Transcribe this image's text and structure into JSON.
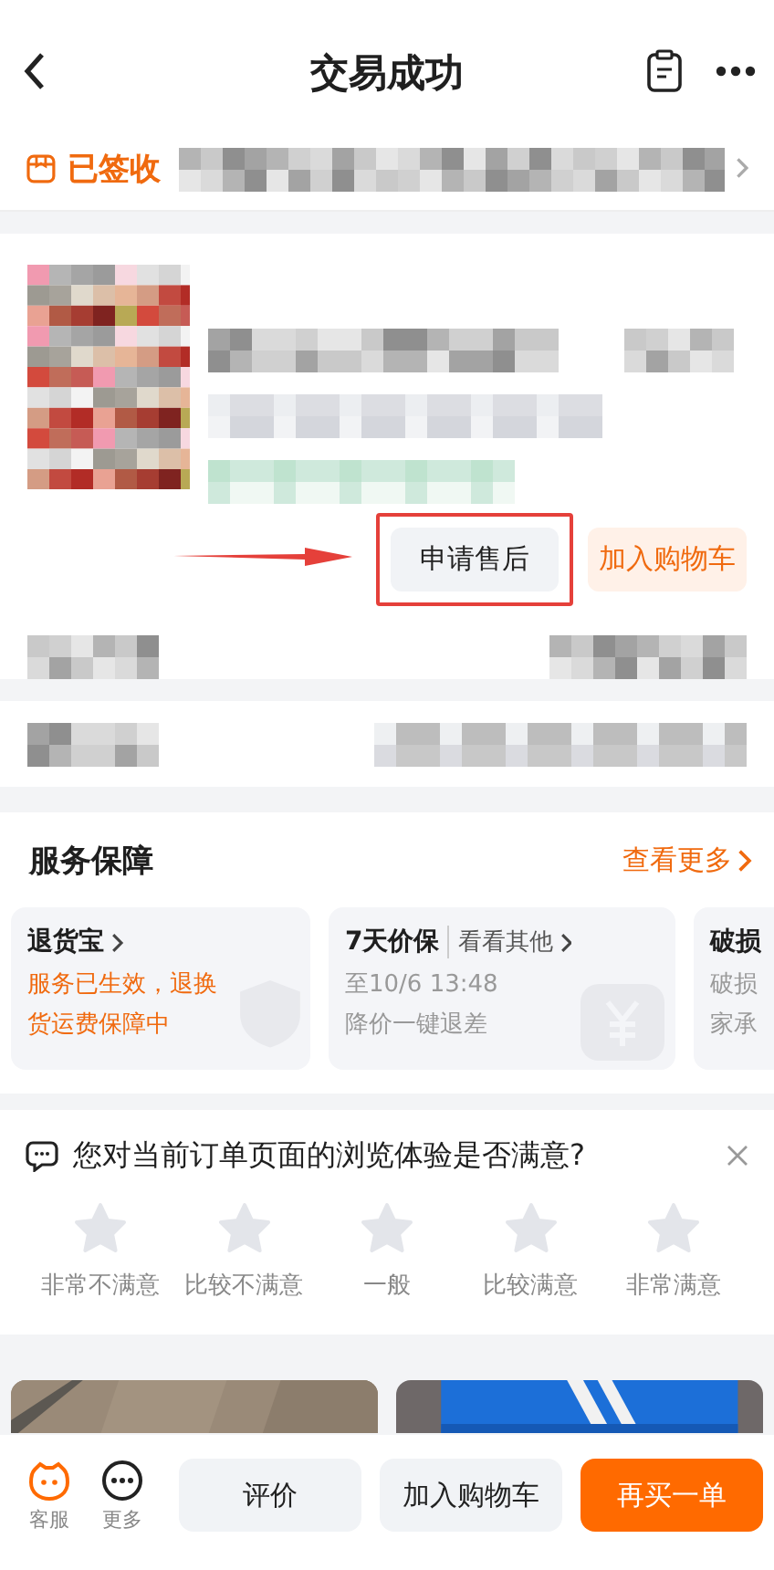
{
  "header": {
    "title": "交易成功"
  },
  "status": {
    "label": "已签收"
  },
  "product": {
    "buttons": [
      {
        "label": "申请售后",
        "kind": "plain",
        "highlighted": true
      },
      {
        "label": "加入购物车",
        "kind": "accent",
        "highlighted": false
      }
    ]
  },
  "services": {
    "title": "服务保障",
    "more": "查看更多",
    "cards": [
      {
        "title": "退货宝",
        "active": true,
        "lines": [
          "服务已生效，退换货运费保障中"
        ],
        "kind": "shield"
      },
      {
        "title": "7天价保",
        "tag": "看看其他",
        "active": false,
        "lines": [
          "至10/6 13:48",
          "降价一键退差"
        ],
        "kind": "price"
      },
      {
        "title": "破损",
        "active": false,
        "lines": [
          "破损",
          "家承"
        ],
        "kind": "plain"
      }
    ]
  },
  "survey": {
    "question": "您对当前订单页面的浏览体验是否满意?",
    "options": [
      "非常不满意",
      "比较不满意",
      "一般",
      "比较满意",
      "非常满意"
    ]
  },
  "bottom_bar": {
    "shortcuts": [
      {
        "label": "客服",
        "kind": "service"
      },
      {
        "label": "更多",
        "kind": "more"
      }
    ],
    "buttons": [
      {
        "label": "评价",
        "kind": "plain"
      },
      {
        "label": "加入购物车",
        "kind": "plain"
      },
      {
        "label": "再买一单",
        "kind": "primary"
      }
    ]
  }
}
